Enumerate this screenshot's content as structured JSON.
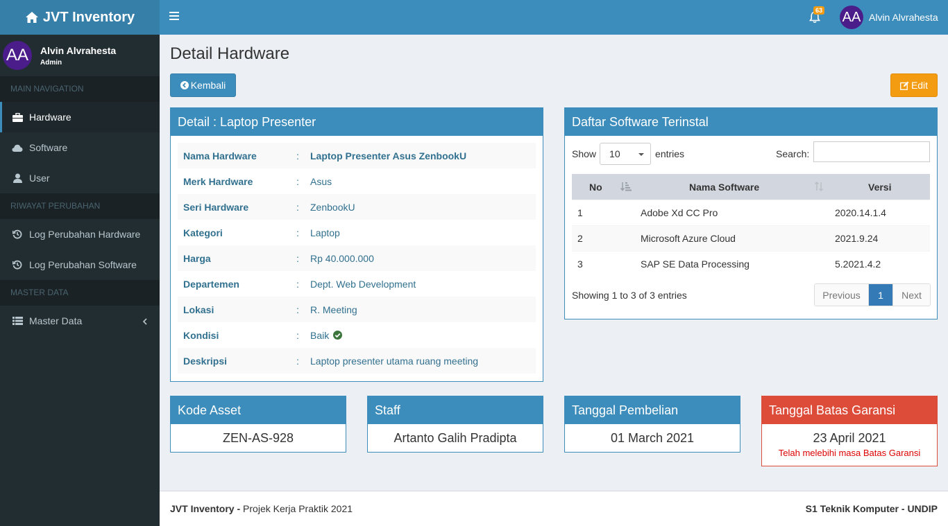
{
  "app": {
    "title": "JVT Inventory"
  },
  "header": {
    "notification_count": "63",
    "user_initials": "AA",
    "user_name": "Alvin Alvrahesta"
  },
  "sidebar": {
    "user": {
      "initials": "AA",
      "name": "Alvin Alvrahesta",
      "role": "Admin"
    },
    "headers": [
      "MAIN NAVIGATION",
      "RIWAYAT PERUBAHAN",
      "MASTER DATA"
    ],
    "items": [
      {
        "label": "Hardware",
        "icon": "briefcase-icon"
      },
      {
        "label": "Software",
        "icon": "cloud-icon"
      },
      {
        "label": "User",
        "icon": "user-icon"
      },
      {
        "label": "Log Perubahan Hardware",
        "icon": "history-icon"
      },
      {
        "label": "Log Perubahan Software",
        "icon": "history-icon"
      },
      {
        "label": "Master Data",
        "icon": "list-icon"
      }
    ]
  },
  "page": {
    "title": "Detail Hardware",
    "back_label": "Kembali",
    "edit_label": "Edit"
  },
  "detail": {
    "title": "Detail : Laptop Presenter",
    "separator": ":",
    "rows": [
      {
        "key": "Nama Hardware",
        "value": "Laptop Presenter Asus ZenbookU"
      },
      {
        "key": "Merk Hardware",
        "value": "Asus"
      },
      {
        "key": "Seri Hardware",
        "value": "ZenbookU"
      },
      {
        "key": "Kategori",
        "value": "Laptop"
      },
      {
        "key": "Harga",
        "value": "Rp 40.000.000"
      },
      {
        "key": "Departemen",
        "value": "Dept. Web Development"
      },
      {
        "key": "Lokasi",
        "value": "R. Meeting"
      },
      {
        "key": "Kondisi",
        "value": "Baik"
      },
      {
        "key": "Deskripsi",
        "value": "Laptop presenter utama ruang meeting"
      }
    ]
  },
  "software": {
    "title": "Daftar Software Terinstal",
    "show_label": "Show",
    "page_size": "10",
    "entries_label": "entries",
    "search_label": "Search:",
    "search_value": "",
    "columns": [
      "No",
      "Nama Software",
      "Versi"
    ],
    "rows": [
      {
        "no": "1",
        "name": "Adobe Xd CC Pro",
        "version": "2020.14.1.4"
      },
      {
        "no": "2",
        "name": "Microsoft Azure Cloud",
        "version": "2021.9.24"
      },
      {
        "no": "3",
        "name": "SAP SE Data Processing",
        "version": "5.2021.4.2"
      }
    ],
    "info": "Showing 1 to 3 of 3 entries",
    "prev_label": "Previous",
    "current_page": "1",
    "next_label": "Next"
  },
  "cards": {
    "asset": {
      "title": "Kode Asset",
      "value": "ZEN-AS-928"
    },
    "staff": {
      "title": "Staff",
      "value": "Artanto Galih Pradipta"
    },
    "purchase": {
      "title": "Tanggal Pembelian",
      "value": "01 March 2021"
    },
    "warranty": {
      "title": "Tanggal Batas Garansi",
      "value": "23 April 2021",
      "note": "Telah melebihi masa Batas Garansi"
    }
  },
  "footer": {
    "brand": "JVT Inventory",
    "dash": "-",
    "project": "Projek Kerja Praktik 2021",
    "right": "S1 Teknik Komputer - UNDIP"
  },
  "colors": {
    "primary": "#3c8dbc",
    "warning": "#f39c12",
    "danger": "#dd4b39",
    "sidebar": "#222d32",
    "avatar": "#4b1d8a"
  }
}
